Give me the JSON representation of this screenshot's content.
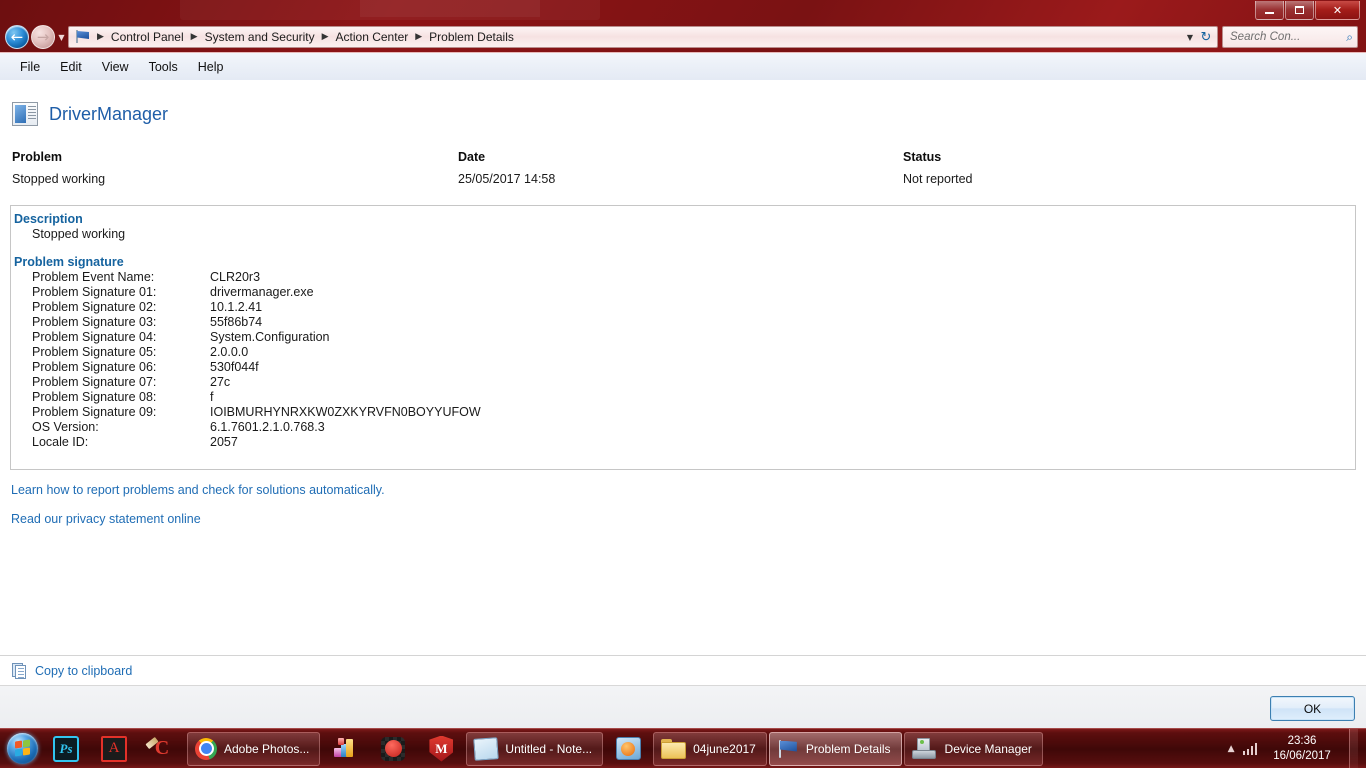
{
  "window": {
    "min_label": "Minimize",
    "max_label": "Restore",
    "close_label": "✕"
  },
  "nav": {
    "back_glyph": "←",
    "forward_glyph": "→",
    "history_glyph": "▼",
    "dropdown_glyph": "▼",
    "refresh_glyph": "↻"
  },
  "breadcrumb": {
    "items": [
      "Control Panel",
      "System and Security",
      "Action Center",
      "Problem Details"
    ],
    "separator": "▶"
  },
  "search": {
    "placeholder": "Search Con...",
    "icon": "search-icon",
    "glyph": "⌕"
  },
  "menu": {
    "items": [
      "File",
      "Edit",
      "View",
      "Tools",
      "Help"
    ]
  },
  "app": {
    "name": "DriverManager"
  },
  "columns": {
    "problem_header": "Problem",
    "problem_value": "Stopped working",
    "date_header": "Date",
    "date_value": "25/05/2017 14:58",
    "status_header": "Status",
    "status_value": "Not reported"
  },
  "description": {
    "title": "Description",
    "text": "Stopped working"
  },
  "signature": {
    "title": "Problem signature",
    "rows": [
      {
        "key": "Problem Event Name:",
        "value": "CLR20r3"
      },
      {
        "key": "Problem Signature 01:",
        "value": "drivermanager.exe"
      },
      {
        "key": "Problem Signature 02:",
        "value": "10.1.2.41"
      },
      {
        "key": "Problem Signature 03:",
        "value": "55f86b74"
      },
      {
        "key": "Problem Signature 04:",
        "value": "System.Configuration"
      },
      {
        "key": "Problem Signature 05:",
        "value": "2.0.0.0"
      },
      {
        "key": "Problem Signature 06:",
        "value": "530f044f"
      },
      {
        "key": "Problem Signature 07:",
        "value": "27c"
      },
      {
        "key": "Problem Signature 08:",
        "value": "f"
      },
      {
        "key": "Problem Signature 09:",
        "value": "IOIBMURHYNRXKW0ZXKYRVFN0BOYYUFOW"
      },
      {
        "key": "OS Version:",
        "value": "6.1.7601.2.1.0.768.3"
      },
      {
        "key": "Locale ID:",
        "value": "2057"
      }
    ]
  },
  "links": {
    "learn_more": "Learn how to report problems and check for solutions automatically.",
    "privacy": "Read our privacy statement online"
  },
  "copy": {
    "label": "Copy to clipboard",
    "icon": "copy-icon"
  },
  "footer": {
    "ok_label": "OK"
  },
  "taskbar": {
    "start_label": "Start",
    "pinned": [
      {
        "name": "photoshop",
        "label": "Ps"
      },
      {
        "name": "acrobat-reader",
        "label": "A"
      },
      {
        "name": "ccleaner",
        "label": "C"
      },
      {
        "name": "download-manager",
        "label": ""
      },
      {
        "name": "recorder",
        "label": ""
      },
      {
        "name": "mcafee",
        "label": "M"
      },
      {
        "name": "media-player",
        "label": ""
      }
    ],
    "tasks": [
      {
        "name": "chrome",
        "label": "Adobe Photos...",
        "active": false
      },
      {
        "name": "notepad",
        "label": "Untitled - Note...",
        "active": false
      },
      {
        "name": "explorer-folder",
        "label": "04june2017",
        "active": false
      },
      {
        "name": "problem-details",
        "label": "Problem Details",
        "active": true
      },
      {
        "name": "device-manager",
        "label": "Device Manager",
        "active": false
      }
    ],
    "tray": {
      "arrow_glyph": "▲",
      "network_icon": "network-signal-icon",
      "time": "23:36",
      "date": "16/06/2017"
    }
  },
  "colors": {
    "accent_link": "#1f6db5",
    "section_heading": "#15639f",
    "app_title": "#1f5ea8",
    "taskbar": "#5c0e0e",
    "desktop": "#8e1416"
  }
}
